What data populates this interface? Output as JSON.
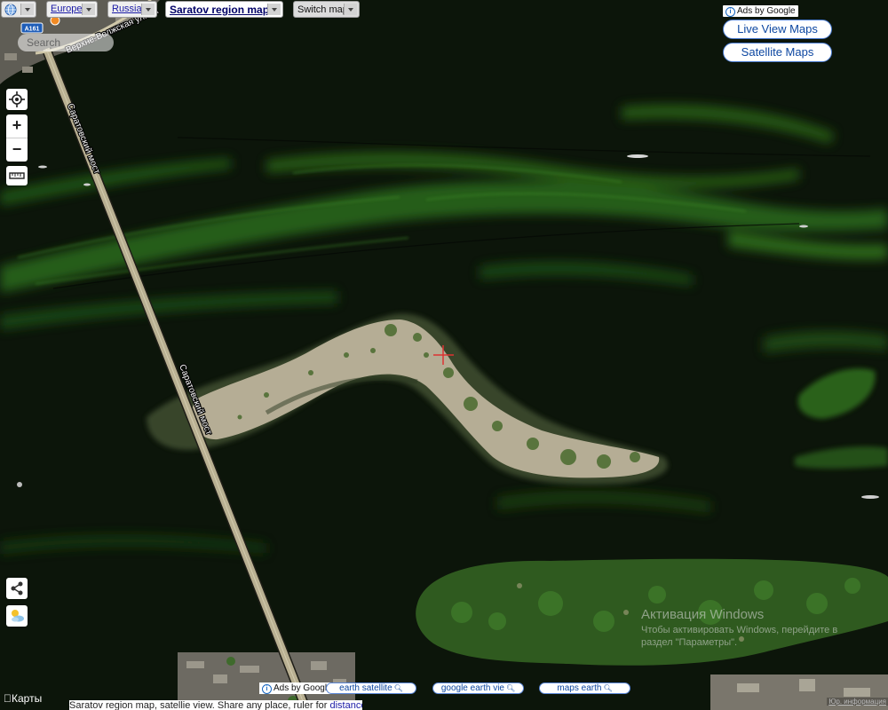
{
  "nav": {
    "globe_icon": "globe-icon",
    "breadcrumbs": [
      {
        "label": "Europe"
      },
      {
        "label": "Russia"
      },
      {
        "label": "Saratov region map"
      }
    ],
    "switch_map_label": "Switch map"
  },
  "search": {
    "placeholder": "Search"
  },
  "map_controls": {
    "locate_icon": "locate-crosshair-icon",
    "zoom_in": "+",
    "zoom_out": "−",
    "ruler_icon": "ruler-icon",
    "share_icon": "share-icon",
    "weather_icon": "weather-icon"
  },
  "map_labels": {
    "bridge_label_1": "Саратовский мост",
    "bridge_label_2": "Саратовский мост",
    "street_label": "Верхне-Волжская улица",
    "road_shield": "А161"
  },
  "ads_top": {
    "tag": "Ads by Google",
    "buttons": [
      {
        "label": "Live View Maps"
      },
      {
        "label": "Satellite Maps"
      }
    ]
  },
  "ads_bottom": {
    "tag": "Ads by Google",
    "pills": [
      {
        "label": "earth satellite"
      },
      {
        "label": "google earth vie"
      },
      {
        "label": "maps earth"
      }
    ]
  },
  "caption": {
    "text": "Saratov region map, satellie view. Share any place, ruler for ",
    "link": "distance"
  },
  "attribution": {
    "apple_maps": "Карты"
  },
  "watermark": {
    "title": "Активация Windows",
    "line1": "Чтобы активировать Windows, перейдите в",
    "line2": "раздел \"Параметры\"."
  },
  "legal_link": "Юр. информация",
  "colors": {
    "water": "#0a1209",
    "algae": "#2c6a1a",
    "sand": "#b5ad95",
    "forest": "#2f5a1f",
    "bridge": "#b9b092",
    "ad_border": "#4a7bd0",
    "ad_text": "#0d47a1"
  }
}
